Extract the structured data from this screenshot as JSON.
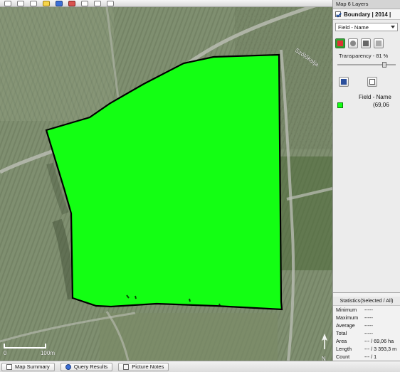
{
  "map": {
    "road_name": "Szőlőkalja",
    "scale": {
      "left_label": "0",
      "right_label": "100m"
    },
    "north_label": "N"
  },
  "panel": {
    "header": "Map 6 Layers",
    "layer": {
      "name": "Boundary | 2014 |",
      "checked": true
    },
    "field_select": {
      "value": "Field - Name"
    },
    "transparency_label": "Transparency - 81 %",
    "transparency_value": 0.81,
    "legend": {
      "title": "Field - Name",
      "value": "(69,06"
    },
    "stats": {
      "title": "Statistics(Selected / All)",
      "rows": [
        {
          "key": "Minimum",
          "value": "-----"
        },
        {
          "key": "Maximum",
          "value": "-----"
        },
        {
          "key": "Average",
          "value": "-----"
        },
        {
          "key": "Total",
          "value": "-----"
        },
        {
          "key": "Area",
          "value": "--- / 69,06 ha"
        },
        {
          "key": "Length",
          "value": "--- / 3 393,3 m"
        },
        {
          "key": "Count",
          "value": "--- / 1"
        }
      ]
    }
  },
  "bottom_tabs": [
    {
      "label": "Map Summary",
      "icon": "map-summary-icon"
    },
    {
      "label": "Query Results",
      "icon": "help-icon"
    },
    {
      "label": "Picture Notes",
      "icon": "camera-icon"
    }
  ],
  "colors": {
    "field_fill": "#13ff13",
    "field_stroke": "#000000"
  }
}
